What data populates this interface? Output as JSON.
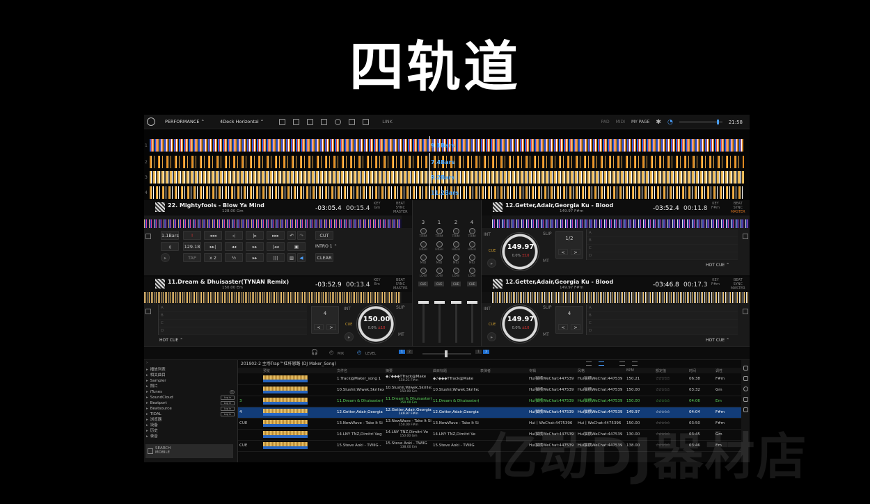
{
  "headline": "四轨道",
  "watermark": "亿动DJ器材店",
  "toolbar": {
    "mode": "PERFORMANCE",
    "layout": "4Deck Horizontal",
    "link": "LINK",
    "pad": "PAD",
    "midi": "MIDI",
    "my_page": "MY PAGE",
    "clock": "21:58"
  },
  "waveforms": [
    {
      "num": "1",
      "bars": "9.1Bars"
    },
    {
      "num": "2",
      "bars": "7.4Bars"
    },
    {
      "num": "3",
      "bars": "9.2Bars"
    },
    {
      "num": "4",
      "bars": "11.2Bars"
    }
  ],
  "decks": {
    "d1": {
      "title": "22. Mightyfools - Blow Ya Mind",
      "sub": "128.00  Gm",
      "remain": "-03:05.4",
      "elapsed": "00:15.4"
    },
    "d2": {
      "title": "12.Getter,Adair,Georgia Ku - Blood",
      "sub": "149.97  F#m",
      "remain": "-03:52.4",
      "elapsed": "00:11.8"
    },
    "d3": {
      "title": "11.Dream & Dhuisaster(TYNAN Remix)",
      "sub": "150.00  Em",
      "remain": "-03:52.9",
      "elapsed": "00:13.4"
    },
    "d4": {
      "title": "12.Getter,Adair,Georgia Ku - Blood",
      "sub": "149.97  F#m",
      "remain": "-03:46.8",
      "elapsed": "00:17.3"
    }
  },
  "deck_labels": {
    "key": "KEY",
    "sync": "SYNC",
    "beat": "BEAT",
    "master": "MASTER",
    "em": "Em",
    "gm": "Gm",
    "fm": "F#m",
    "slip": "SLIP",
    "int": "INT",
    "cue": "CUE",
    "mt": "MT",
    "hot_cue": "HOT CUE"
  },
  "deck1_ctrl": {
    "bars": "1.1Bars",
    "bpm": "129.18",
    "cut": "CUT",
    "intro": "INTRO 1",
    "clear": "CLEAR",
    "tap": "TAP",
    "x2": "x 2"
  },
  "deck2_ctrl": {
    "loop": "1/2",
    "jog_bpm": "149.97",
    "jog_pct": "0.0%",
    "jog_range": "±10"
  },
  "deck3_ctrl": {
    "loop": "4",
    "jog_bpm": "150.00",
    "jog_pct": "0.0%",
    "jog_range": "±10"
  },
  "deck4_ctrl": {
    "loop": "4",
    "jog_bpm": "149.97",
    "jog_pct": "0.0%",
    "jog_range": "±10"
  },
  "pad_letters": [
    "A",
    "B",
    "C",
    "D",
    "E",
    "F",
    "G",
    "H"
  ],
  "mixer": {
    "channels": [
      "3",
      "1",
      "2",
      "4"
    ],
    "knobs": [
      "TRIM",
      "HIGH",
      "MID",
      "LOW"
    ],
    "cue": "CUE"
  },
  "mixbar": {
    "mix": "MIX",
    "level": "LEVEL"
  },
  "browser": {
    "tree": [
      "播放列表",
      "相关曲目",
      "Sampler",
      "照片",
      "iTunes",
      "SoundCloud",
      "Beatport",
      "Beatsource",
      "TIDAL",
      "浏览器",
      "设备",
      "历史",
      "录音"
    ],
    "login": "Log in",
    "search_mobile_1": "SEARCH",
    "search_mobile_2": "MOBILE",
    "playlist_title": "201902-2 主场Trap™杠杆恩路 (DJ Maker_Song)",
    "columns": [
      "",
      "预览",
      "文件名",
      "摘要",
      "曲目标题",
      "表演者",
      "专辑",
      "风格",
      "BPM",
      "额定值",
      "时间",
      "调性"
    ],
    "rows": [
      {
        "state": "",
        "file": "1.Track@Maker_song 1",
        "sum": "◆♪◆◆◆TTrack@Make",
        "sum2": "150.21  F#m",
        "title": "◆♪◆◆◆TTrack@Make",
        "album": "Hui猫横WeChat:447539",
        "genre": "Hui猫横WeChat:447539",
        "bpm": "150.21",
        "time": "06:38",
        "key": "F#m"
      },
      {
        "state": "",
        "file": "10.Slushii,Wiwek,Skrillex",
        "sum": "10.Slushii,Wiwek,Skrillex",
        "sum2": "150.00  Gm",
        "title": "10.Slushii,Wiwek,Skrillex",
        "album": "Hui猫横WeChat:447539",
        "genre": "Hui猫横WeChat:447539",
        "bpm": "150.00",
        "time": "03:32",
        "key": "Gm"
      },
      {
        "state": "3",
        "file": "11.Dream & Dhuisaster(",
        "sum": "11.Dream & Dhuisaster(",
        "sum2": "150.00  Em",
        "title": "11.Dream & Dhuisaster(",
        "album": "Hui猫横WeChat:447539",
        "genre": "Hui猫横WeChat:447539",
        "bpm": "150.00",
        "time": "04:06",
        "key": "Em"
      },
      {
        "state": "4",
        "file": "12.Getter,Adair,Georgia",
        "sum": "12.Getter,Adair,Georgia",
        "sum2": "149.97  F#m",
        "title": "12.Getter,Adair,Georgia",
        "album": "Hui猫横WeChat:447539",
        "genre": "Hui猫横WeChat:447539",
        "bpm": "149.97",
        "time": "04:04",
        "key": "F#m"
      },
      {
        "state": "CUE",
        "file": "13.NewWave - Take It Si",
        "sum": "13.NewWave - Take It Si",
        "sum2": "150.00  F#m",
        "title": "13.NewWave - Take It Si",
        "album": "Hui丨WeChat:4475396",
        "genre": "Hui丨WeChat:4475396",
        "bpm": "150.00",
        "time": "03:50",
        "key": "F#m"
      },
      {
        "state": "",
        "file": "14.LNY TNZ,Dimitri Veg",
        "sum": "14.LNY TNZ,Dimitri Ve",
        "sum2": "150.00  Gm",
        "title": "14.LNY TNZ,Dimitri Ve",
        "album": "Hui猫横WeChat:447539",
        "genre": "Hui猫横WeChat:447539",
        "bpm": "130.00",
        "time": "03:45",
        "key": "Gm"
      },
      {
        "state": "CUE",
        "file": "15.Steve Aoki - TWIIG -",
        "sum": "15.Steve Aoki - TWIIG",
        "sum2": "138.00  Em",
        "title": "15.Steve Aoki - TWIIG",
        "album": "Hui猫横WeChat:447539",
        "genre": "Hui猫横WeChat:447539",
        "bpm": "138.00",
        "time": "03:46",
        "key": "Em"
      }
    ],
    "rating": "☆☆☆☆☆"
  }
}
